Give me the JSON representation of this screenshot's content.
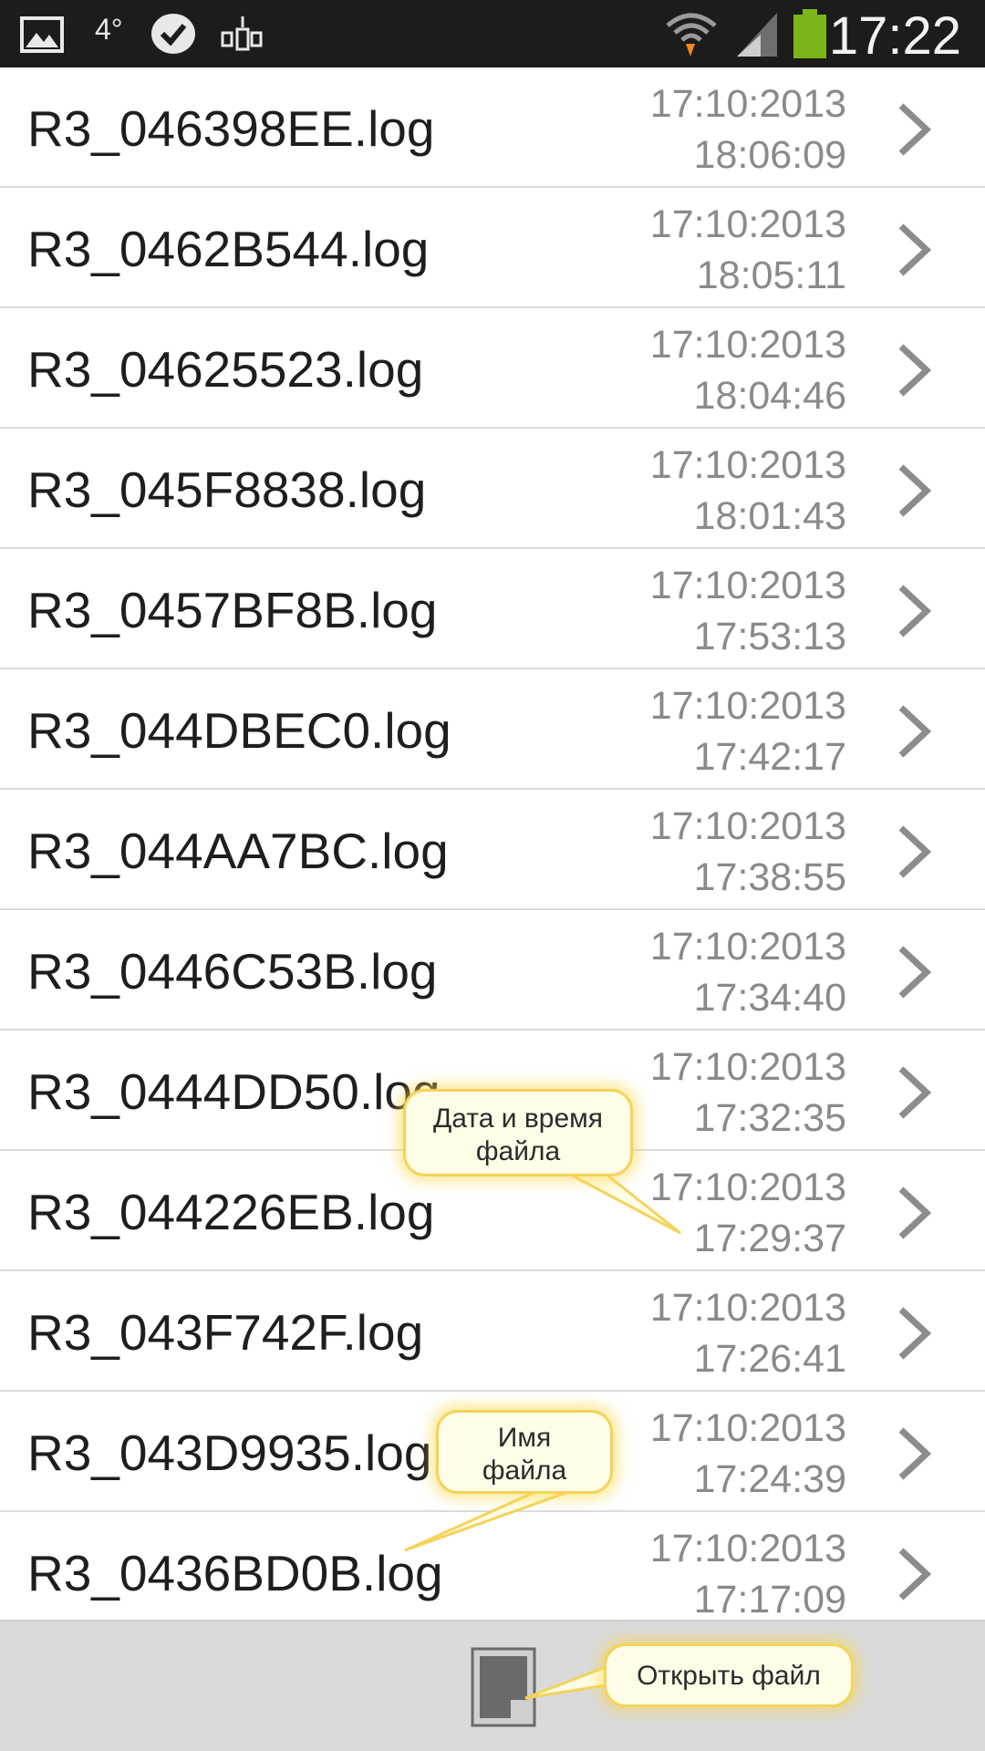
{
  "status_bar": {
    "temperature": "4°",
    "time": "17:22",
    "icons": [
      "image-icon",
      "weather-icon",
      "check-icon",
      "service-icon",
      "wifi-icon",
      "signal-icon",
      "battery-icon"
    ],
    "battery_color": "#7cb518"
  },
  "files": [
    {
      "name": "R3_046398EE.log",
      "date": "17:10:2013",
      "time": "18:06:09"
    },
    {
      "name": "R3_0462B544.log",
      "date": "17:10:2013",
      "time": "18:05:11"
    },
    {
      "name": "R3_04625523.log",
      "date": "17:10:2013",
      "time": "18:04:46"
    },
    {
      "name": "R3_045F8838.log",
      "date": "17:10:2013",
      "time": "18:01:43"
    },
    {
      "name": "R3_0457BF8B.log",
      "date": "17:10:2013",
      "time": "17:53:13"
    },
    {
      "name": "R3_044DBEC0.log",
      "date": "17:10:2013",
      "time": "17:42:17"
    },
    {
      "name": "R3_044AA7BC.log",
      "date": "17:10:2013",
      "time": "17:38:55"
    },
    {
      "name": "R3_0446C53B.log",
      "date": "17:10:2013",
      "time": "17:34:40"
    },
    {
      "name": "R3_0444DD50.log",
      "date": "17:10:2013",
      "time": "17:32:35"
    },
    {
      "name": "R3_044226EB.log",
      "date": "17:10:2013",
      "time": "17:29:37"
    },
    {
      "name": "R3_043F742F.log",
      "date": "17:10:2013",
      "time": "17:26:41"
    },
    {
      "name": "R3_043D9935.log",
      "date": "17:10:2013",
      "time": "17:24:39"
    },
    {
      "name": "R3_0436BD0B.log",
      "date": "17:10:2013",
      "time": "17:17:09"
    }
  ],
  "callouts": {
    "datetime_line1": "Дата и время",
    "datetime_line2": "файла",
    "name_line1": "Имя",
    "name_line2": "файла",
    "open_file": "Открыть файл"
  },
  "colors": {
    "status_bar_bg": "#1c1c1c",
    "bottom_bar_bg": "#dadada",
    "callout_border": "#f4d35a"
  }
}
